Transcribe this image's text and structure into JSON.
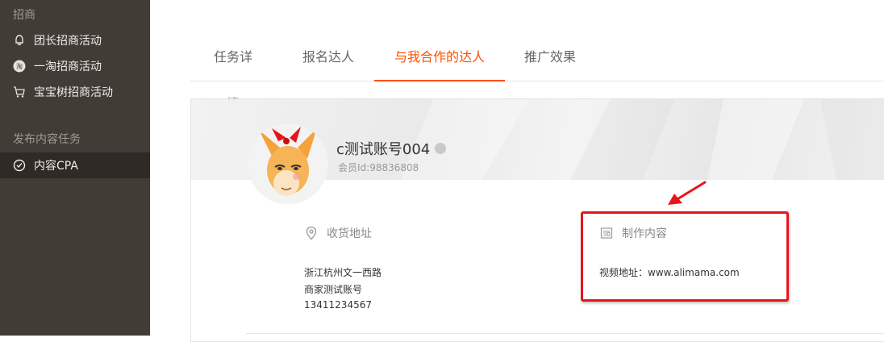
{
  "sidebar": {
    "section_recruit": "招商",
    "items": [
      {
        "label": "团长招商活动",
        "icon": "group-bell-icon"
      },
      {
        "label": "一淘招商活动",
        "icon": "yitao-logo-icon"
      },
      {
        "label": "宝宝树招商活动",
        "icon": "cart-icon"
      }
    ],
    "section_publish": "发布内容任务",
    "active_item": {
      "label": "内容CPA",
      "icon": "check-circle-icon"
    }
  },
  "tabs": [
    {
      "label": "任务详情",
      "active": false
    },
    {
      "label": "报名达人",
      "active": false
    },
    {
      "label": "与我合作的达人",
      "active": true
    },
    {
      "label": "推广效果",
      "active": false
    }
  ],
  "profile": {
    "name": "c测试账号004",
    "member_id": "会员Id:98836808"
  },
  "shipping": {
    "title": "收货地址",
    "lines": [
      "浙江杭州文一西路",
      "商家测试账号",
      "13411234567"
    ]
  },
  "content": {
    "title": "制作内容",
    "video_url": "视频地址：www.alimama.com"
  },
  "colors": {
    "sidebar_bg": "#423c37",
    "accent": "#ff5000",
    "annotation": "#e8141c"
  }
}
